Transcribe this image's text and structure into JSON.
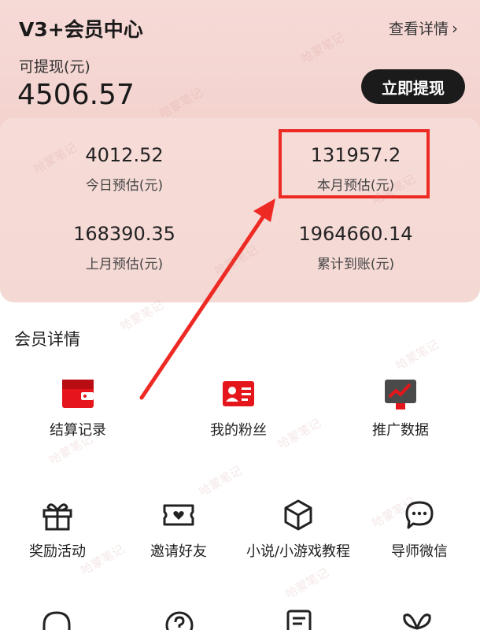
{
  "header": {
    "title": "V3+会员中心",
    "view_details": "查看详情",
    "withdrawable_label": "可提现(元)",
    "withdrawable_amount": "4506.57",
    "withdraw_button": "立即提现"
  },
  "stats": [
    {
      "value": "4012.52",
      "label": "今日预估(元)"
    },
    {
      "value": "131957.2",
      "label": "本月预估(元)"
    },
    {
      "value": "168390.35",
      "label": "上月预估(元)"
    },
    {
      "value": "1964660.14",
      "label": "累计到账(元)"
    }
  ],
  "member_details": {
    "title": "会员详情",
    "row1": [
      {
        "label": "结算记录",
        "icon": "wallet-icon"
      },
      {
        "label": "我的粉丝",
        "icon": "fans-card-icon"
      },
      {
        "label": "推广数据",
        "icon": "trend-chart-icon"
      }
    ],
    "row2": [
      {
        "label": "奖励活动",
        "icon": "gift-icon"
      },
      {
        "label": "邀请好友",
        "icon": "ticket-heart-icon"
      },
      {
        "label": "小说/小游戏教程",
        "icon": "cube-icon"
      },
      {
        "label": "导师微信",
        "icon": "chat-bubble-icon"
      }
    ],
    "row3_icons": [
      "headset-icon",
      "help-icon",
      "document-icon",
      "butterfly-icon"
    ]
  },
  "watermark": "哈蒙笔记",
  "colors": {
    "accent": "#ee2a24",
    "dark_button": "#1b1b1b",
    "hero_bg": "#f2cfca"
  }
}
